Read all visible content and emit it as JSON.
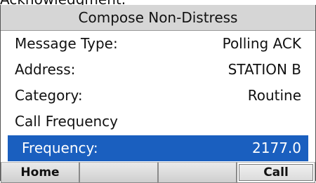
{
  "caption": "Acknowledgment.",
  "screen": {
    "title": "Compose Non-Distress",
    "fields": [
      {
        "label": "Message Type:",
        "value": "Polling ACK"
      },
      {
        "label": "Address:",
        "value": "STATION B"
      },
      {
        "label": "Category:",
        "value": "Routine"
      },
      {
        "label": "Call Frequency",
        "value": ""
      }
    ],
    "selected": {
      "label": "Frequency:",
      "value": "2177.0"
    },
    "softkeys": [
      "Home",
      "",
      "",
      "Call"
    ]
  },
  "colors": {
    "title_bar": "#d6d6d6",
    "selection": "#1a5fbf"
  }
}
